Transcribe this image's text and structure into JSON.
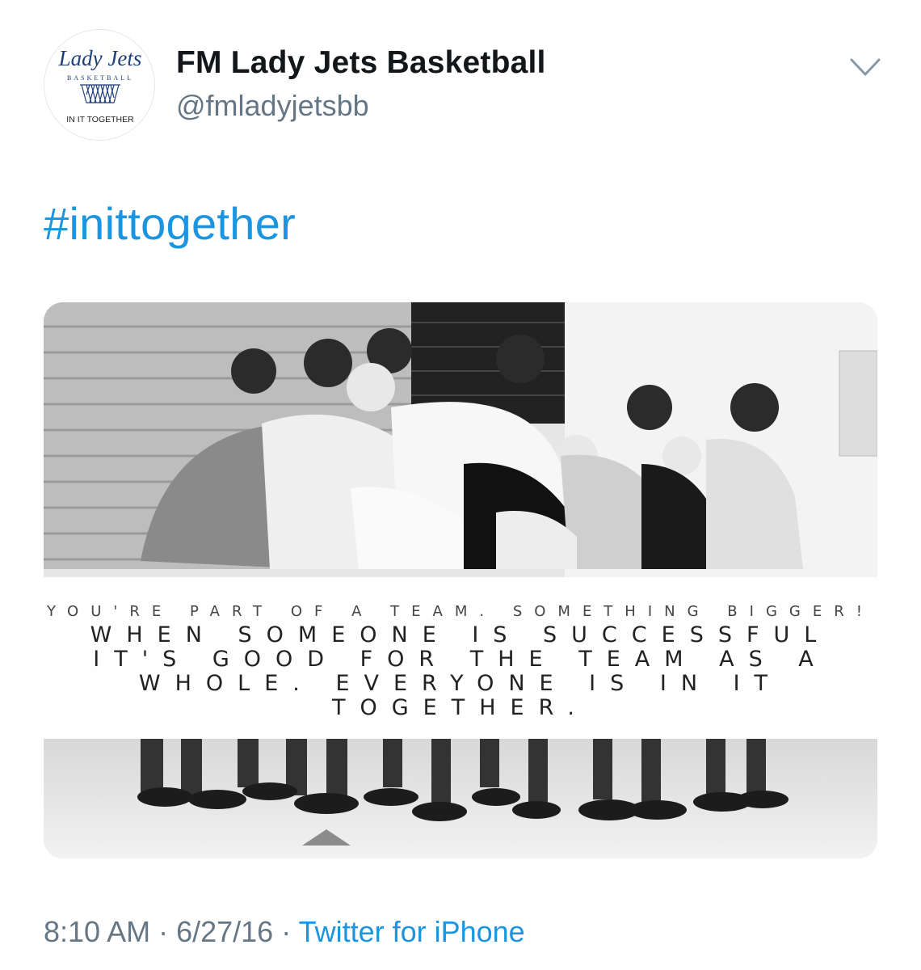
{
  "tweet": {
    "avatar": {
      "logo_script": "Lady Jets",
      "logo_sub": "BASKETBALL",
      "logo_tagline": "IN IT TOGETHER"
    },
    "display_name": "FM Lady Jets Basketball",
    "handle": "@fmladyjetsbb",
    "hashtag": "#inittogether",
    "image": {
      "quote_line1": "YOU'RE PART OF A TEAM. SOMETHING BIGGER!",
      "quote_body": "WHEN SOMEONE IS SUCCESSFUL IT'S GOOD FOR THE TEAM AS A WHOLE. EVERYONE IS IN IT TOGETHER."
    },
    "time": "8:10 AM",
    "separator": " · ",
    "date": "6/27/16",
    "source": "Twitter for iPhone"
  },
  "colors": {
    "link_blue": "#1b95e0",
    "secondary_text": "#657786",
    "primary_text": "#14171a",
    "logo_navy": "#1f3f78"
  }
}
